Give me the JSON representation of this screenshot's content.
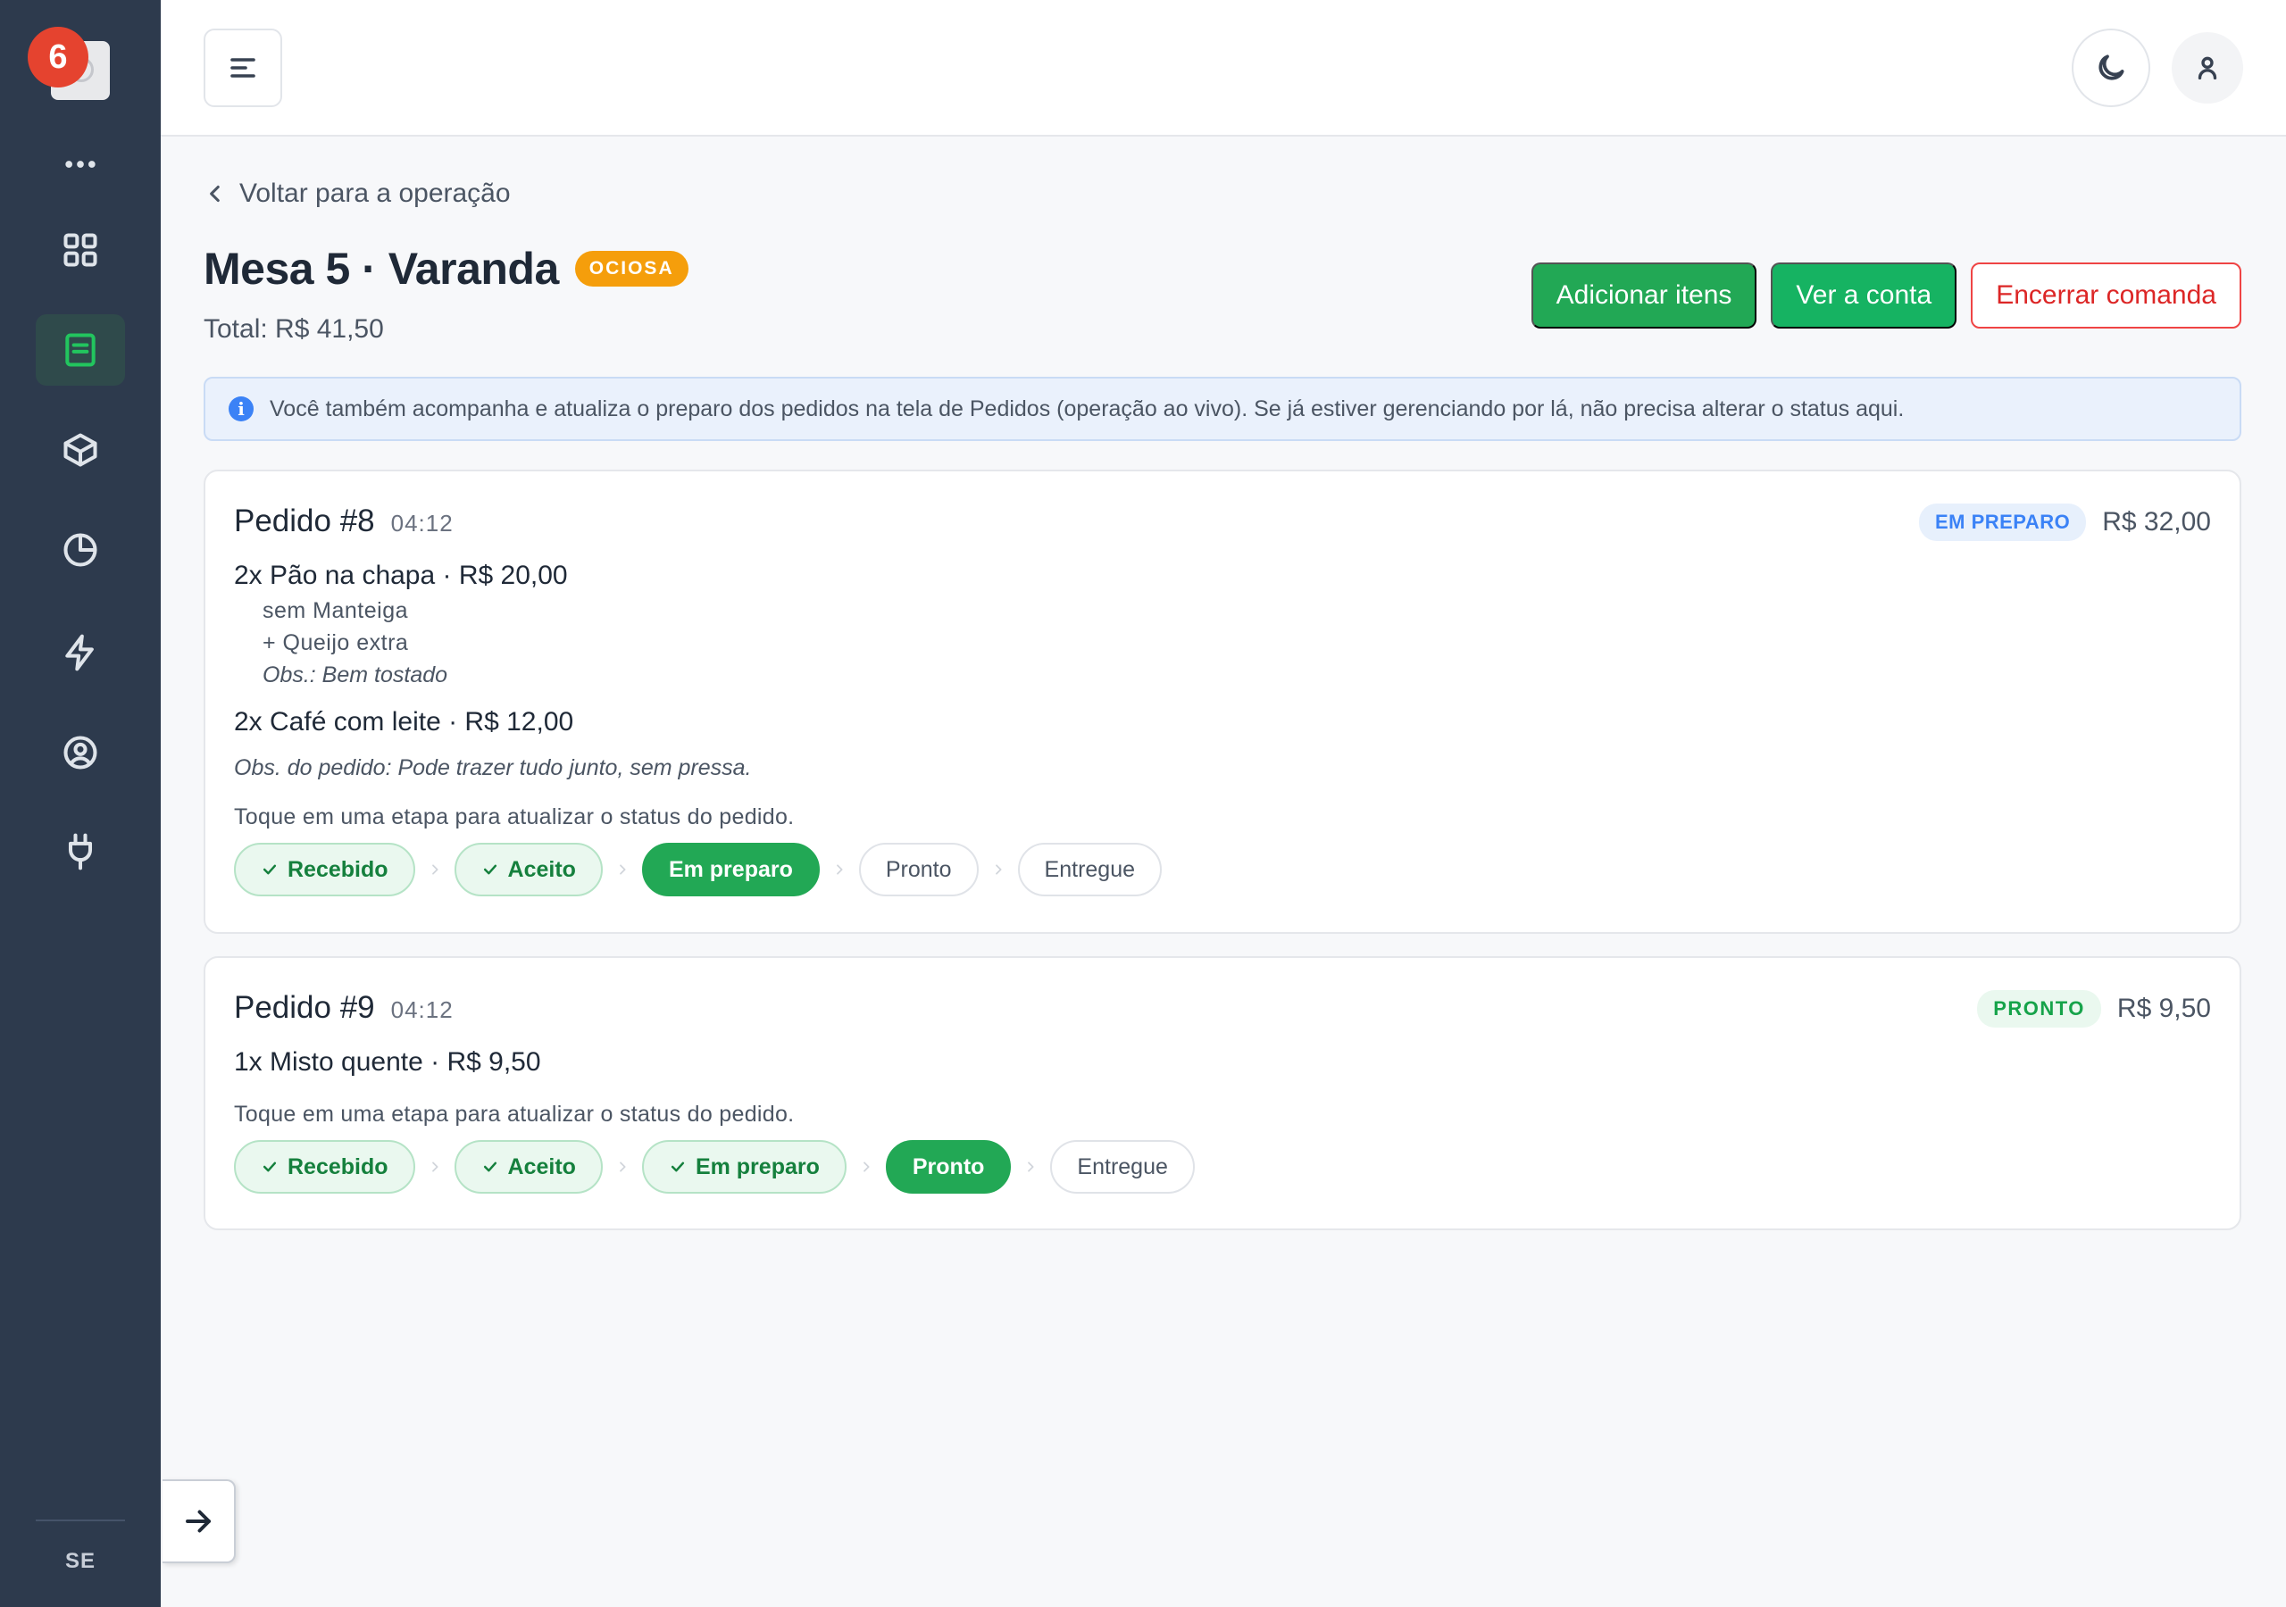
{
  "sidebar": {
    "notification_count": "6",
    "footer_label": "SE",
    "items": [
      {
        "icon": "more-horizontal-icon"
      },
      {
        "icon": "grid-icon"
      },
      {
        "icon": "list-icon",
        "active": true
      },
      {
        "icon": "box-icon"
      },
      {
        "icon": "pie-chart-icon"
      },
      {
        "icon": "lightning-icon"
      },
      {
        "icon": "user-circle-icon"
      },
      {
        "icon": "plug-icon"
      }
    ]
  },
  "header": {
    "back_label": "Voltar para a operação",
    "title": "Mesa 5 · Varanda",
    "status_badge": "OCIOSA",
    "total": "Total: R$ 41,50"
  },
  "actions": {
    "add_items": "Adicionar itens",
    "view_bill": "Ver a conta",
    "close_tab": "Encerrar comanda"
  },
  "info_banner": "Você também acompanha e atualiza o preparo dos pedidos na tela de Pedidos (operação ao vivo). Se já estiver gerenciando por lá, não precisa alterar o status aqui.",
  "orders": [
    {
      "title": "Pedido #8",
      "time": "04:12",
      "status": "EM PREPARO",
      "total": "R$ 32,00",
      "items": [
        {
          "text": "2x Pão na chapa · R$ 20,00",
          "mods": [
            "sem Manteiga",
            "+ Queijo extra"
          ],
          "note": "Obs.: Bem tostado"
        },
        {
          "text": "2x Café com leite · R$ 12,00"
        }
      ],
      "order_note": "Obs. do pedido: Pode trazer tudo junto, sem pressa.",
      "hint": "Toque em uma etapa para atualizar o status do pedido.",
      "steps": [
        "Recebido",
        "Aceito",
        "Em preparo",
        "Pronto",
        "Entregue"
      ]
    },
    {
      "title": "Pedido #9",
      "time": "04:12",
      "status": "PRONTO",
      "total": "R$ 9,50",
      "items": [
        {
          "text": "1x Misto quente · R$ 9,50"
        }
      ],
      "hint": "Toque em uma etapa para atualizar o status do pedido.",
      "steps": [
        "Recebido",
        "Aceito",
        "Em preparo",
        "Pronto",
        "Entregue"
      ]
    }
  ],
  "colors": {
    "sidebar_bg": "#2d3a4d",
    "primary_green": "#22a855",
    "danger_red": "#dc2626",
    "badge_orange": "#f59e0b",
    "info_blue": "#3b82f6"
  }
}
